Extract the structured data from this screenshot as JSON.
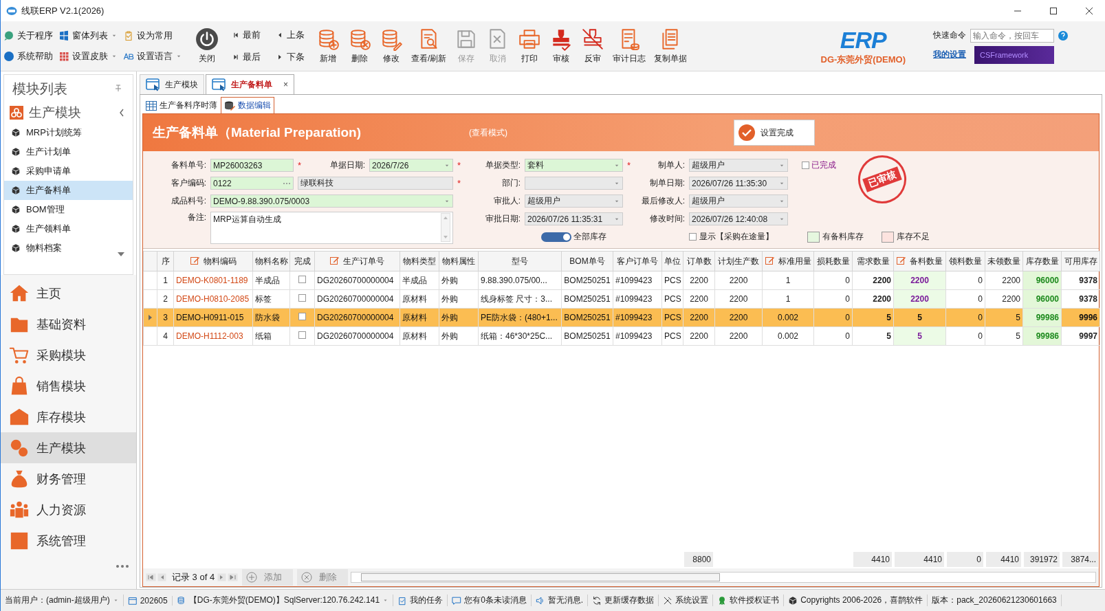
{
  "window": {
    "title": "线联ERP V2.1(2026)"
  },
  "ribbon": {
    "small_items": [
      {
        "label": "关于程序",
        "dropdown": false
      },
      {
        "label": "窗体列表",
        "dropdown": true
      },
      {
        "label": "设为常用",
        "dropdown": false
      },
      {
        "label": "系统帮助",
        "dropdown": false
      },
      {
        "label": "设置皮肤",
        "dropdown": true
      },
      {
        "label": "设置语言",
        "dropdown": true
      }
    ],
    "close": "关闭",
    "nav": [
      "最前",
      "上条",
      "最后",
      "下条"
    ],
    "actions": [
      {
        "label": "新增",
        "disabled": false
      },
      {
        "label": "删除",
        "disabled": false
      },
      {
        "label": "修改",
        "disabled": false
      },
      {
        "label": "查看/刷新",
        "disabled": false
      },
      {
        "label": "保存",
        "disabled": true
      },
      {
        "label": "取消",
        "disabled": true
      },
      {
        "label": "打印",
        "disabled": false
      },
      {
        "label": "审核",
        "disabled": false
      },
      {
        "label": "反审",
        "disabled": false
      },
      {
        "label": "审计日志",
        "disabled": false
      },
      {
        "label": "复制单据",
        "disabled": false
      }
    ],
    "logo": {
      "text": "ERP",
      "company": "DG-东莞外贸(DEMO)"
    },
    "quick_command": {
      "label": "快速命令",
      "placeholder": "输入命令，按回车"
    },
    "my_settings": "我的设置",
    "banner": "CSFramework"
  },
  "sidebar": {
    "title": "模块列表",
    "group": "生产模块",
    "items": [
      {
        "label": "MRP计划统筹",
        "selected": false
      },
      {
        "label": "生产计划单",
        "selected": false
      },
      {
        "label": "采购申请单",
        "selected": false
      },
      {
        "label": "生产备料单",
        "selected": true
      },
      {
        "label": "BOM管理",
        "selected": false
      },
      {
        "label": "生产领料单",
        "selected": false
      },
      {
        "label": "物料档案",
        "selected": false
      }
    ],
    "modules": [
      {
        "label": "主页",
        "selected": false
      },
      {
        "label": "基础资料",
        "selected": false
      },
      {
        "label": "采购模块",
        "selected": false
      },
      {
        "label": "销售模块",
        "selected": false
      },
      {
        "label": "库存模块",
        "selected": false
      },
      {
        "label": "生产模块",
        "selected": true
      },
      {
        "label": "财务管理",
        "selected": false
      },
      {
        "label": "人力资源",
        "selected": false
      },
      {
        "label": "系统管理",
        "selected": false
      }
    ]
  },
  "tabs": [
    {
      "label": "生产模块",
      "selected": false,
      "closable": false
    },
    {
      "label": "生产备料单",
      "selected": true,
      "closable": true
    }
  ],
  "close_mark": "×",
  "subtabs": [
    {
      "label": "生产备料序时薄",
      "selected": false
    },
    {
      "label": "数据编辑",
      "selected": true
    }
  ],
  "header": {
    "title": "生产备料单（Material Preparation)",
    "mode": "(查看模式)",
    "button": "设置完成"
  },
  "form": {
    "fields": [
      {
        "label": "备料单号:",
        "value": "MP26003263",
        "required_mark": "*",
        "dropdown": false,
        "highlight": true,
        "kind": "text"
      },
      {
        "label": "单据日期:",
        "value": "2026/7/26",
        "required_mark": "*",
        "dropdown": true,
        "highlight": true,
        "kind": "text"
      },
      {
        "label": "单据类型:",
        "value": "套料",
        "required_mark": "*",
        "dropdown": true,
        "highlight": true,
        "kind": "text"
      },
      {
        "label": "制单人:",
        "value": "超级用户",
        "dropdown": true,
        "highlight": false,
        "kind": "text"
      },
      {
        "label": "客户编码:",
        "value": "0122",
        "dropdown": false,
        "highlight": true,
        "kind": "lookup"
      },
      {
        "value": "绿联科技",
        "required_mark": "*",
        "dropdown": false,
        "highlight": false,
        "kind": "text"
      },
      {
        "label": "部门:",
        "dropdown": true,
        "highlight": false,
        "kind": "text"
      },
      {
        "label": "制单日期:",
        "value": "2026/07/26 11:35:30",
        "dropdown": true,
        "highlight": false,
        "kind": "text"
      },
      {
        "label": "成品料号:",
        "value": "DEMO-9.88.390.075/0003",
        "dropdown": true,
        "highlight": true,
        "kind": "text"
      },
      {
        "label": "审批人:",
        "value": "超级用户",
        "dropdown": true,
        "highlight": false,
        "kind": "text"
      },
      {
        "label": "最后修改人:",
        "value": "超级用户",
        "dropdown": true,
        "highlight": false,
        "kind": "text"
      },
      {
        "label": "备注:",
        "value": "MRP运算自动生成",
        "dropdown": false,
        "highlight": false,
        "kind": "memo"
      },
      {
        "label": "审批日期:",
        "value": "2026/07/26 11:35:31",
        "dropdown": true,
        "highlight": false,
        "kind": "text"
      },
      {
        "label": "修改时间:",
        "value": "2026/07/26 12:40:08",
        "dropdown": true,
        "highlight": false,
        "kind": "text"
      }
    ],
    "completed": {
      "label": "已完成",
      "checked": false
    },
    "stamp": "已审核",
    "toggle": {
      "label": "全部库存",
      "on": true
    },
    "in_transit": {
      "label": "显示【采购在途量】",
      "checked": false
    },
    "legend": [
      {
        "label": "有备料库存",
        "color": "#e6f7df"
      },
      {
        "label": "库存不足",
        "color": "#fde3df"
      }
    ]
  },
  "grid": {
    "columns": [
      {
        "label": "序",
        "kind": "index",
        "editable": false
      },
      {
        "label": "物料编码",
        "kind": "code",
        "editable": true
      },
      {
        "label": "物料名称",
        "kind": "text",
        "editable": false
      },
      {
        "label": "完成",
        "kind": "check",
        "editable": false
      },
      {
        "label": "生产订单号",
        "kind": "text",
        "editable": true
      },
      {
        "label": "物料类型",
        "kind": "text",
        "editable": false
      },
      {
        "label": "物料属性",
        "kind": "text",
        "editable": false
      },
      {
        "label": "型号",
        "kind": "text",
        "editable": false
      },
      {
        "label": "BOM单号",
        "kind": "center",
        "editable": false
      },
      {
        "label": "客户订单号",
        "kind": "text",
        "editable": false
      },
      {
        "label": "单位",
        "kind": "center",
        "editable": false
      },
      {
        "label": "订单数",
        "kind": "center",
        "editable": false,
        "total": "8800"
      },
      {
        "label": "计划生产数",
        "kind": "center",
        "editable": false
      },
      {
        "label": "标准用量",
        "kind": "edit",
        "editable": true
      },
      {
        "label": "损耗数量",
        "kind": "number",
        "editable": false
      },
      {
        "label": "需求数量",
        "kind": "bold",
        "editable": false,
        "total": "4410"
      },
      {
        "label": "备料数量",
        "kind": "prep",
        "editable": true,
        "total": "4410"
      },
      {
        "label": "领料数量",
        "kind": "number",
        "editable": false,
        "total": "0"
      },
      {
        "label": "未领数量",
        "kind": "number",
        "editable": false,
        "total": "4410"
      },
      {
        "label": "库存数量",
        "kind": "stock",
        "editable": false,
        "total": "391972"
      },
      {
        "label": "可用库存",
        "kind": "bold",
        "editable": false,
        "total": "3874..."
      }
    ],
    "rows": [
      {
        "selected": false,
        "cells": [
          "1",
          "DEMO-K0801-1189",
          "半成品",
          false,
          "DG20260700000004",
          "半成品",
          "外购",
          "9.88.390.075/00...",
          "BOM250251",
          "#1099423",
          "PCS",
          "2200",
          "2200",
          "1",
          "0",
          "2200",
          "2200",
          "0",
          "2200",
          "96000",
          "9378"
        ]
      },
      {
        "selected": false,
        "cells": [
          "2",
          "DEMO-H0810-2085",
          "标签",
          false,
          "DG20260700000004",
          "原材料",
          "外购",
          "线身标签 尺寸：3...",
          "BOM250251",
          "#1099423",
          "PCS",
          "2200",
          "2200",
          "1",
          "0",
          "2200",
          "2200",
          "0",
          "2200",
          "96000",
          "9378"
        ]
      },
      {
        "selected": true,
        "cells": [
          "3",
          "DEMO-H0911-015",
          "防水袋",
          false,
          "DG20260700000004",
          "原材料",
          "外购",
          "PE防水袋：(480+1...",
          "BOM250251",
          "#1099423",
          "PCS",
          "2200",
          "2200",
          "0.002",
          "0",
          "5",
          "5",
          "0",
          "5",
          "99986",
          "9996"
        ]
      },
      {
        "selected": false,
        "cells": [
          "4",
          "DEMO-H1112-003",
          "纸箱",
          false,
          "DG20260700000004",
          "原材料",
          "外购",
          "纸箱：46*30*25C...",
          "BOM250251",
          "#1099423",
          "PCS",
          "2200",
          "2200",
          "0.002",
          "0",
          "5",
          "5",
          "0",
          "5",
          "99986",
          "9997"
        ]
      }
    ]
  },
  "navigator": {
    "record": "记录 3 of 4",
    "buttons": [
      {
        "label": "添加",
        "disabled": true
      },
      {
        "label": "删除",
        "disabled": true
      }
    ]
  },
  "status_bar": [
    {
      "label": "当前用户：(admin-超级用户)",
      "dropdown": true
    },
    {
      "label": "202605",
      "dropdown": false
    },
    {
      "label": "【DG-东莞外贸(DEMO)】SqlServer:120.76.242.141",
      "dropdown": true
    },
    {
      "label": "我的任务",
      "dropdown": false
    },
    {
      "label": "您有0条未读消息",
      "dropdown": false
    },
    {
      "label": "暂无消息.",
      "dropdown": false
    },
    {
      "label": "更新缓存数据",
      "dropdown": false
    },
    {
      "label": "系统设置",
      "dropdown": false
    },
    {
      "label": "软件授权证书",
      "dropdown": false
    },
    {
      "label": "Copyrights 2006-2026，喜鹊软件",
      "dropdown": false
    },
    {
      "label": "版本：pack_20260621230601663",
      "dropdown": false
    }
  ]
}
